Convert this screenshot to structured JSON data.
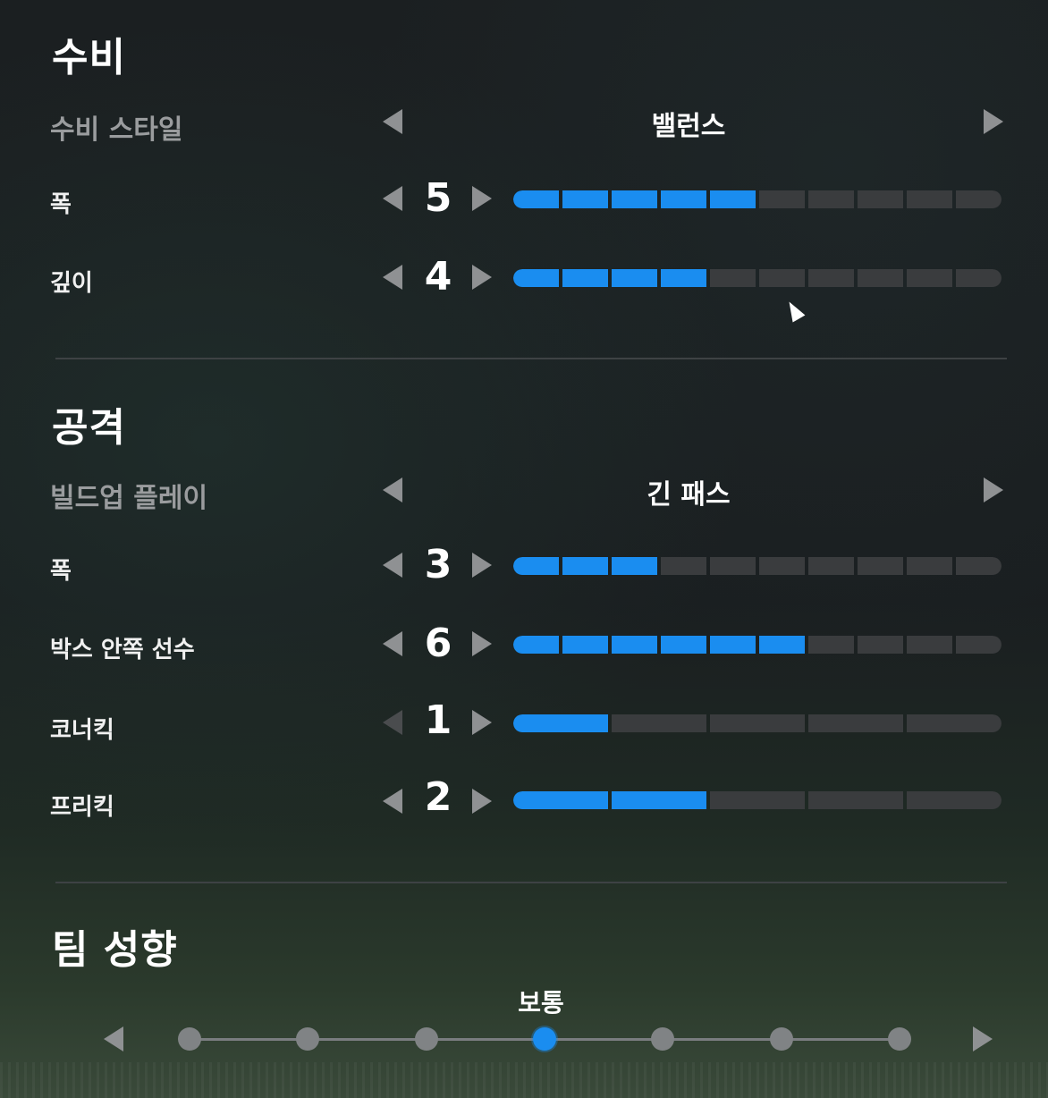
{
  "defense": {
    "title": "수비",
    "style": {
      "label": "수비 스타일",
      "value": "밸런스"
    },
    "sliders": [
      {
        "label": "폭",
        "value": 5,
        "max": 10
      },
      {
        "label": "깊이",
        "value": 4,
        "max": 10
      }
    ]
  },
  "attack": {
    "title": "공격",
    "style": {
      "label": "빌드업 플레이",
      "value": "긴 패스"
    },
    "sliders": [
      {
        "label": "폭",
        "value": 3,
        "max": 10
      },
      {
        "label": "박스 안쪽 선수",
        "value": 6,
        "max": 10
      },
      {
        "label": "코너킥",
        "value": 1,
        "max": 5
      },
      {
        "label": "프리킥",
        "value": 2,
        "max": 5
      }
    ]
  },
  "team_tendency": {
    "title": "팀 성향",
    "current_label": "보통",
    "steps": 7,
    "selected_index": 3
  },
  "colors": {
    "accent": "#1a8df0",
    "inactive": "#3a3c3e"
  },
  "icons": {
    "left": "triangle-left-icon",
    "right": "triangle-right-icon"
  }
}
